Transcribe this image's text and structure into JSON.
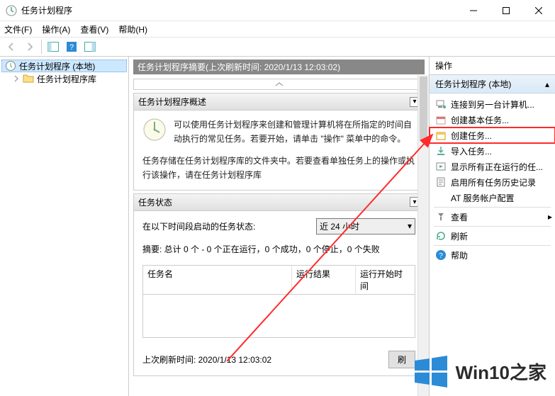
{
  "window": {
    "title": "任务计划程序",
    "min": "minimize",
    "max": "maximize",
    "close": "close"
  },
  "menu": [
    "文件(F)",
    "操作(A)",
    "查看(V)",
    "帮助(H)"
  ],
  "tree": {
    "root": "任务计划程序 (本地)",
    "child": "任务计划程序库"
  },
  "center": {
    "header": "任务计划程序摘要(上次刷新时间: 2020/1/13 12:03:02)",
    "overview_title": "任务计划程序概述",
    "overview_text_1": "可以使用任务计划程序来创建和管理计算机将在所指定的时间自动执行的常见任务。若要开始，请单击 \"操作\" 菜单中的命令。",
    "overview_text_2": "任务存储在任务计划程序库的文件夹中。若要查看单独任务上的操作或执行该操作，请在任务计划程序库",
    "state_title": "任务状态",
    "state_label": "在以下时间段启动的任务状态:",
    "state_select": "近 24 小时",
    "summary": "摘要: 总计 0 个 - 0 个正在运行，0 个成功，0 个停止，0 个失败",
    "columns": [
      "任务名",
      "运行结果",
      "运行开始时间"
    ],
    "last": "上次刷新时间: 2020/1/13 12:03:02",
    "refresh_btn": "刷"
  },
  "actions": {
    "header": "操作",
    "sub": "任务计划程序 (本地)",
    "items": [
      {
        "icon": "connect",
        "label": "连接到另一台计算机..."
      },
      {
        "icon": "basic",
        "label": "创建基本任务..."
      },
      {
        "icon": "create",
        "label": "创建任务...",
        "hl": true
      },
      {
        "icon": "import",
        "label": "导入任务..."
      },
      {
        "icon": "running",
        "label": "显示所有正在运行的任..."
      },
      {
        "icon": "history",
        "label": "启用所有任务历史记录"
      },
      {
        "icon": "at",
        "label": "AT 服务帐户配置"
      },
      {
        "sep": true
      },
      {
        "icon": "view",
        "label": "查看"
      },
      {
        "sep": true
      },
      {
        "icon": "refresh",
        "label": "刷新"
      },
      {
        "sep": true
      },
      {
        "icon": "help",
        "label": "帮助"
      }
    ]
  },
  "watermark": {
    "brand": "Win10",
    "suffix": "之家"
  }
}
